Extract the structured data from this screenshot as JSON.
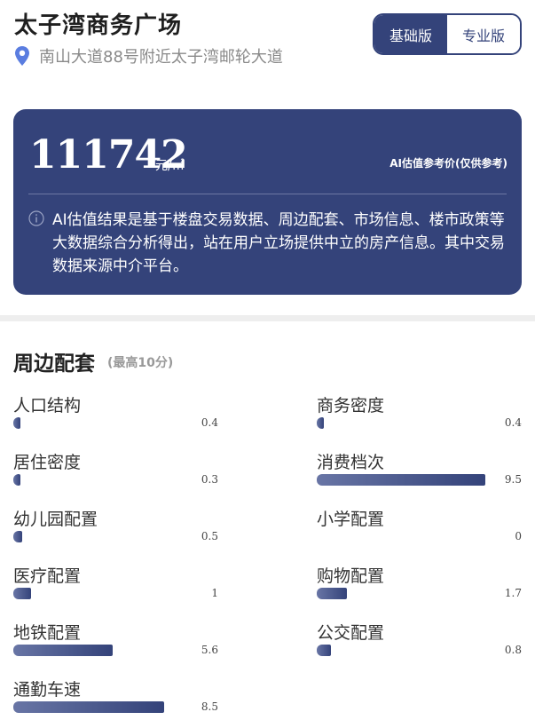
{
  "header": {
    "title": "太子湾商务广场",
    "address": "南山大道88号附近太子湾邮轮大道"
  },
  "version_toggle": {
    "basic": "基础版",
    "pro": "专业版",
    "active": "basic"
  },
  "price_card": {
    "price": "111742",
    "unit": "元/㎡",
    "note": "AI估值参考价(仅供参考)",
    "disclaimer": "AI估值结果是基于楼盘交易数据、周边配套、市场信息、楼市政策等大数据综合分析得出，站在用户立场提供中立的房产信息。其中交易数据来源中介平台。"
  },
  "amenities": {
    "title": "周边配套",
    "subtitle": "(最高10分)",
    "max": 10,
    "items": [
      {
        "label": "人口结构",
        "value": 0.4,
        "value_text": "0.4"
      },
      {
        "label": "商务密度",
        "value": 0.4,
        "value_text": "0.4"
      },
      {
        "label": "居住密度",
        "value": 0.3,
        "value_text": "0.3"
      },
      {
        "label": "消费档次",
        "value": 9.5,
        "value_text": "9.5"
      },
      {
        "label": "幼儿园配置",
        "value": 0.5,
        "value_text": "0.5"
      },
      {
        "label": "小学配置",
        "value": 0,
        "value_text": "0"
      },
      {
        "label": "医疗配置",
        "value": 1,
        "value_text": "1"
      },
      {
        "label": "购物配置",
        "value": 1.7,
        "value_text": "1.7"
      },
      {
        "label": "地铁配置",
        "value": 5.6,
        "value_text": "5.6"
      },
      {
        "label": "公交配置",
        "value": 0.8,
        "value_text": "0.8"
      },
      {
        "label": "通勤车速",
        "value": 8.5,
        "value_text": "8.5"
      }
    ]
  },
  "colors": {
    "primary": "#34437a",
    "bar_start": "#6875a5",
    "muted": "#8a8a8a",
    "pin": "#5a7de0"
  }
}
